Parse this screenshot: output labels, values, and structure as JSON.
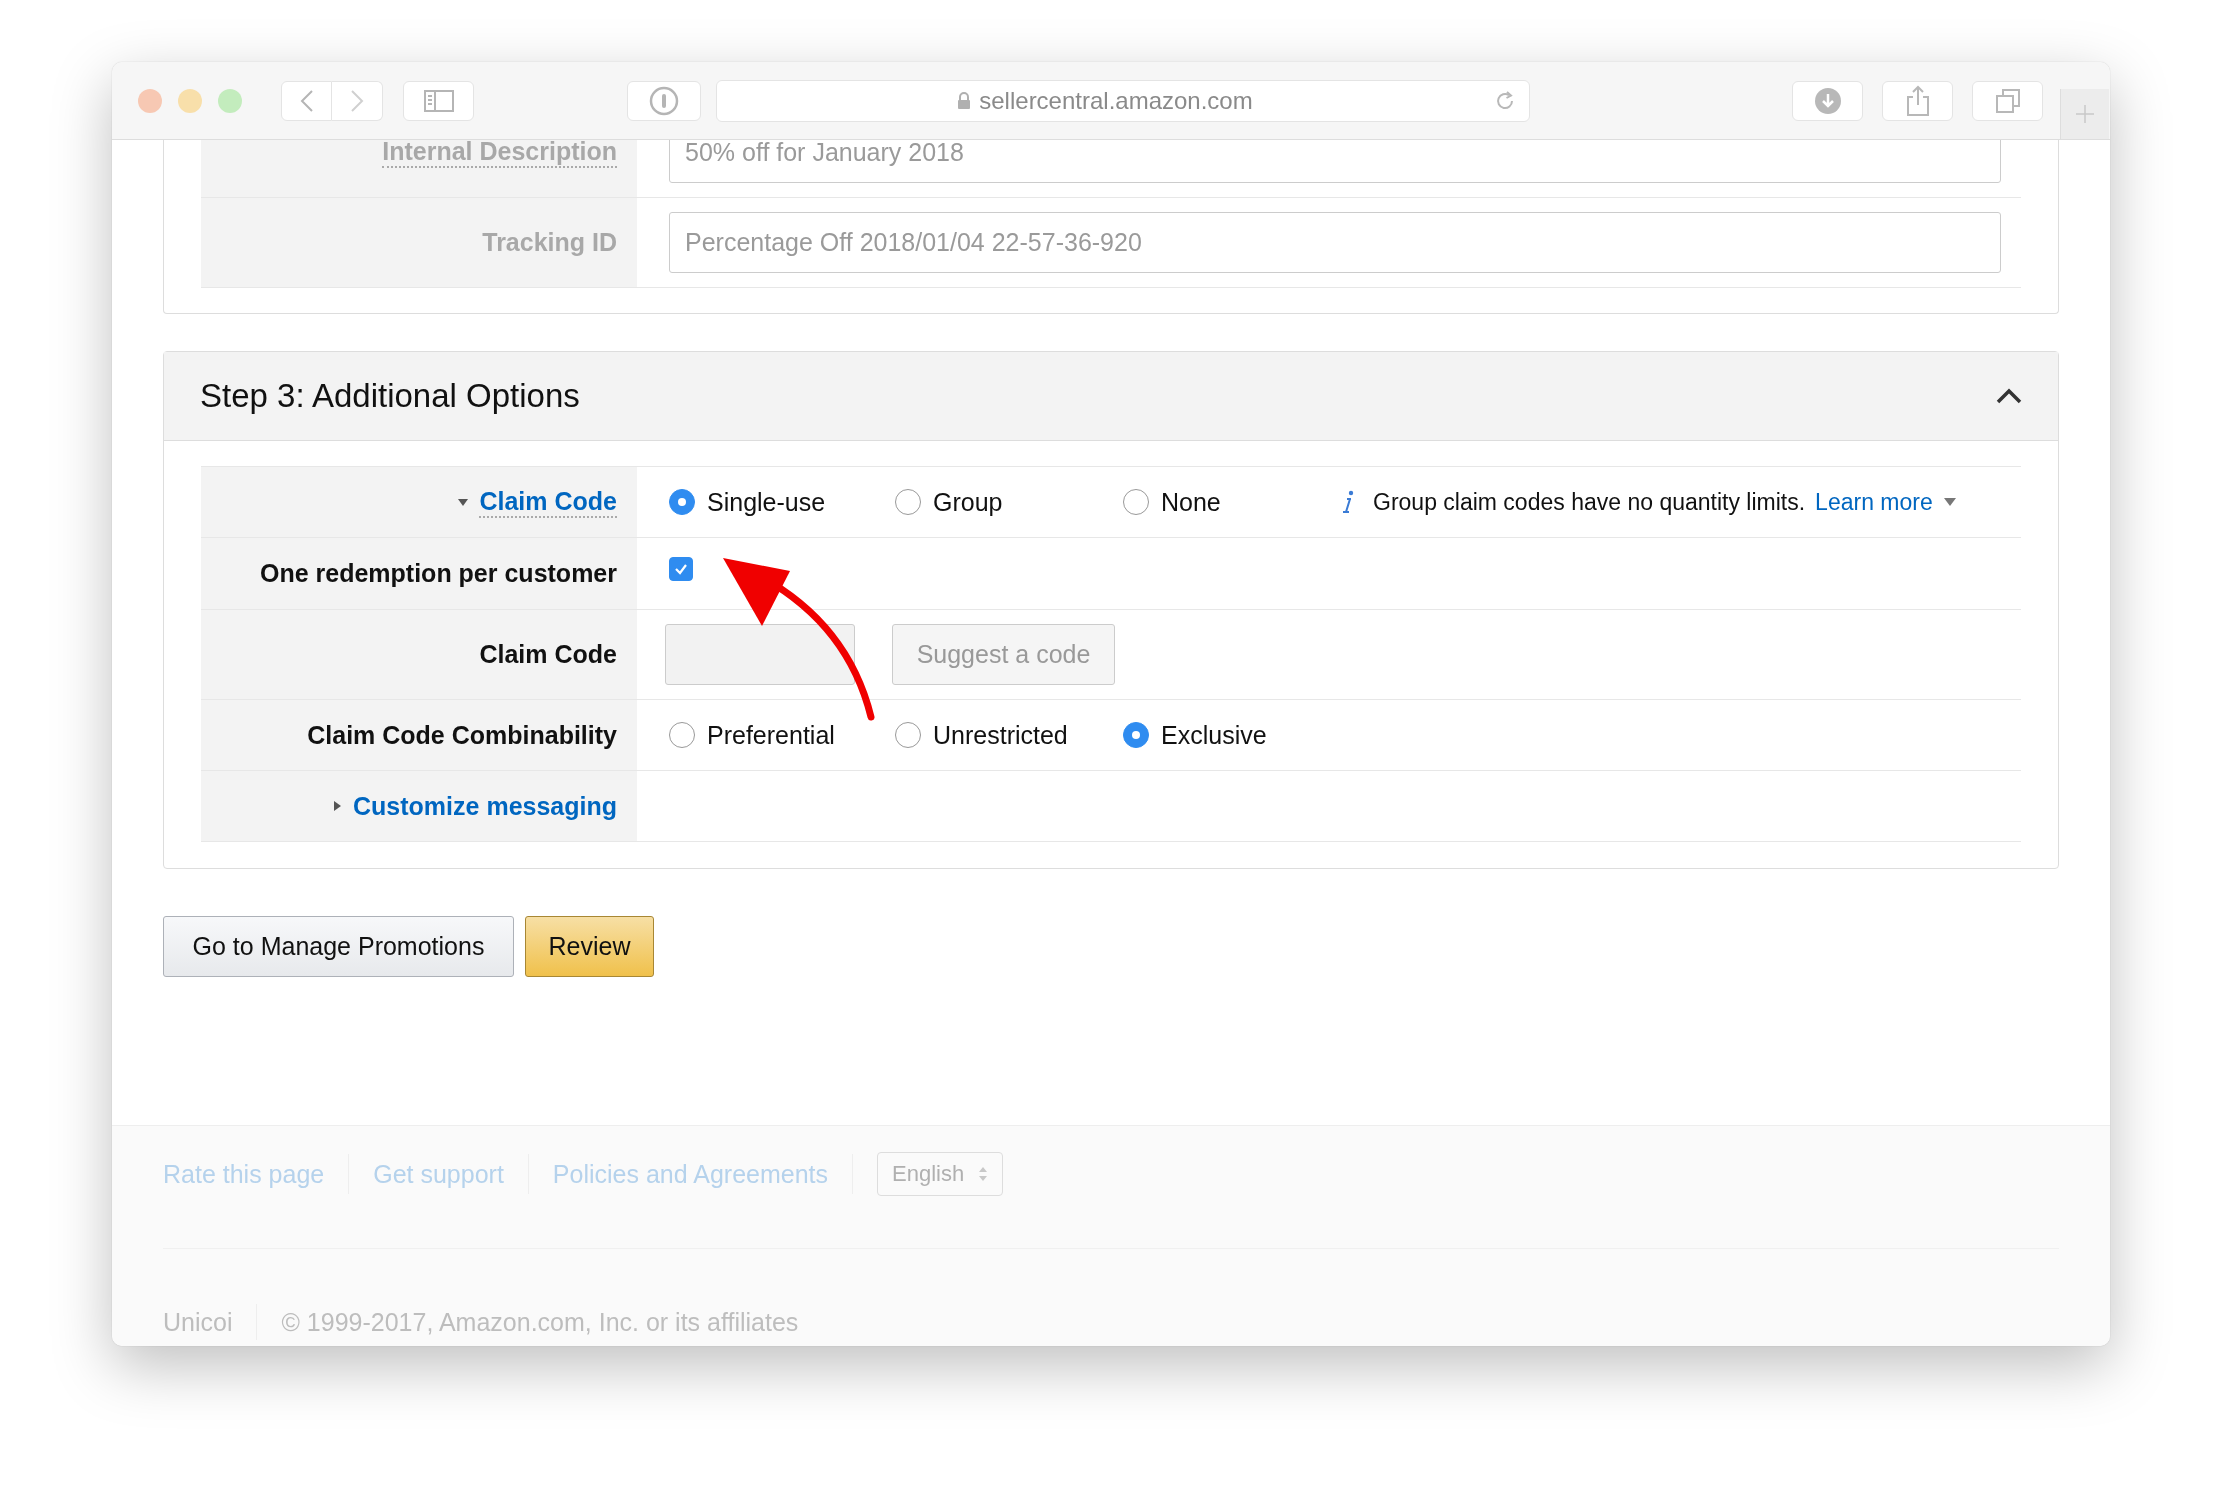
{
  "browser": {
    "url": "sellercentral.amazon.com"
  },
  "top_rows": [
    {
      "label": "Internal Description",
      "value": "50% off for January 2018"
    },
    {
      "label": "Tracking ID",
      "value": "Percentage Off 2018/01/04 22-57-36-920"
    }
  ],
  "section": {
    "title": "Step 3: Additional Options",
    "expanded": true,
    "rows": [
      {
        "kind": "radios",
        "label": {
          "text": "Claim Code",
          "link": true,
          "expanded": true
        },
        "options": [
          {
            "label": "Single-use",
            "selected": true
          },
          {
            "label": "Group",
            "selected": false
          },
          {
            "label": "None",
            "selected": false
          }
        ],
        "info": "Group claim codes have no quantity limits.",
        "info_link": "Learn more"
      },
      {
        "kind": "checkbox",
        "label": {
          "text": "One redemption per customer",
          "link": false
        },
        "checked": true
      },
      {
        "kind": "code",
        "label": {
          "text": "Claim Code",
          "link": false
        },
        "button": "Suggest a code"
      },
      {
        "kind": "radios",
        "label": {
          "text": "Claim Code Combinability",
          "link": false
        },
        "options": [
          {
            "label": "Preferential",
            "selected": false
          },
          {
            "label": "Unrestricted",
            "selected": false
          },
          {
            "label": "Exclusive",
            "selected": true
          }
        ]
      },
      {
        "kind": "empty",
        "label": {
          "text": "Customize messaging",
          "link": true,
          "expanded": false
        }
      }
    ]
  },
  "buttons": [
    {
      "label": "Go to Manage Promotions",
      "kind": "secondary"
    },
    {
      "label": "Review",
      "kind": "primary"
    }
  ],
  "footer": {
    "links": [
      "Rate this page",
      "Get support",
      "Policies and Agreements"
    ],
    "language": "English",
    "bottom": [
      "Unicoi",
      "© 1999-2017, Amazon.com, Inc. or its affiliates"
    ]
  }
}
